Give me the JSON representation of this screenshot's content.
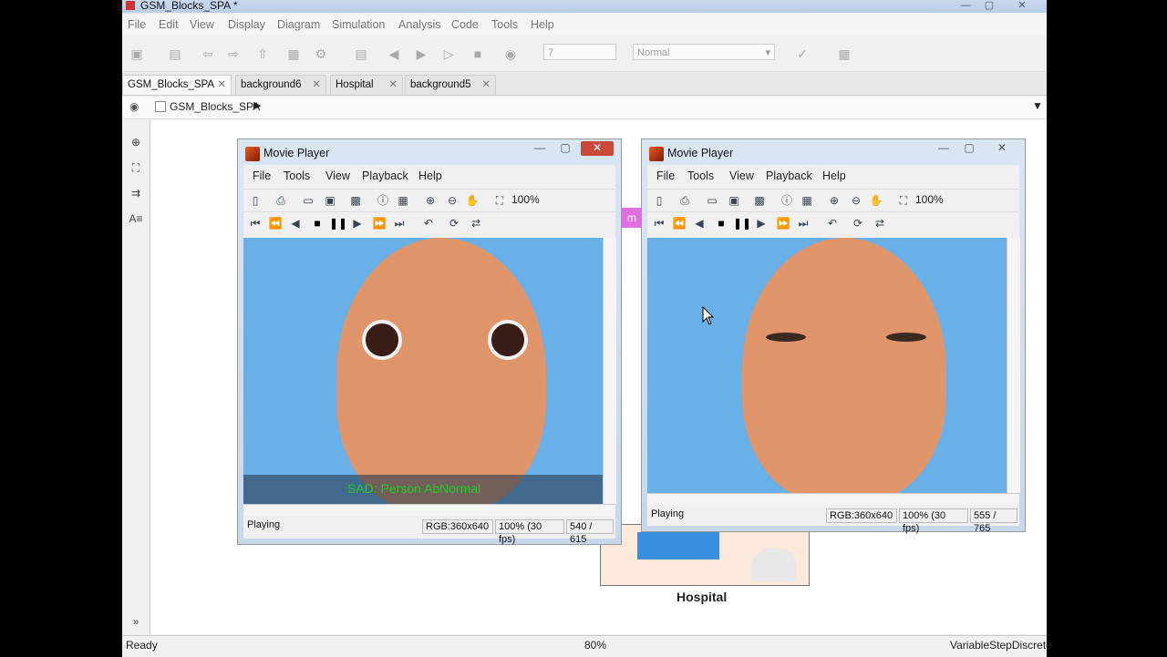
{
  "app": {
    "title": "GSM_Blocks_SPA *",
    "menu": [
      "File",
      "Edit",
      "View",
      "Display",
      "Diagram",
      "Simulation",
      "Analysis",
      "Code",
      "Tools",
      "Help"
    ],
    "sim_stop_time": "7",
    "sim_mode": "Normal",
    "tabs": [
      {
        "label": "GSM_Blocks_SPA",
        "active": true
      },
      {
        "label": "background6",
        "active": false
      },
      {
        "label": "Hospital",
        "active": false
      },
      {
        "label": "background5",
        "active": false
      }
    ],
    "breadcrumb": "GSM_Blocks_SPA",
    "canvas_block_label": "Hospital",
    "canvas_partial_text": "m",
    "status": {
      "left": "Ready",
      "zoom": "80%",
      "solver": "VariableStepDiscrete"
    }
  },
  "player_left": {
    "title": "Movie Player",
    "menu": [
      "File",
      "Tools",
      "View",
      "Playback",
      "Help"
    ],
    "zoom": "100%",
    "overlay_text": "SAD: Person AbNormal",
    "status": "Playing",
    "format": "RGB:360x640",
    "rate": "100% (30 fps)",
    "frame": "540 / 615"
  },
  "player_right": {
    "title": "Movie Player",
    "menu": [
      "File",
      "Tools",
      "View",
      "Playback",
      "Help"
    ],
    "zoom": "100%",
    "status": "Playing",
    "format": "RGB:360x640",
    "rate": "100% (30 fps)",
    "frame": "555 / 765"
  },
  "colors": {
    "overlay_text": "#22cc22",
    "video_bg": "#6ab0e8",
    "skin": "#e89a6e"
  }
}
